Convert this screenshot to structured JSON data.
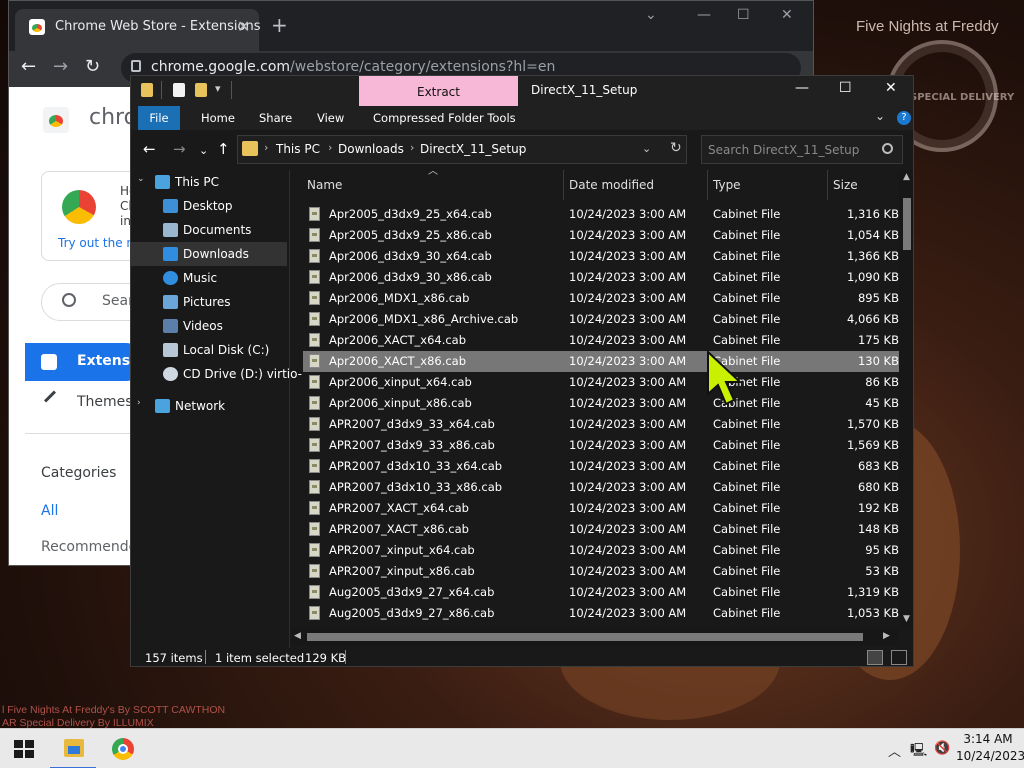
{
  "wallpaper": {
    "title": "Five Nights at Freddy",
    "stamp": "SPECIAL DELIVERY",
    "credit_line1": "l Five Nights At Freddy's By SCOTT CAWTHON",
    "credit_line2": "AR Special Delivery By ILLUMIX"
  },
  "chrome": {
    "tab_title": "Chrome Web Store - Extensions",
    "url_host": "chrome.google.com",
    "url_path": "/webstore/category/extensions?hl=en",
    "store_name": "chro",
    "promo_text_1": "He",
    "promo_text_2": "Ch",
    "promo_text_3": "in",
    "promo_link": "Try out the ne",
    "search_label": "Searc",
    "nav_extensions": "Extensio",
    "nav_themes": "Themes",
    "categories_label": "Categories",
    "all_label": "All",
    "recommended_label": "Recommende"
  },
  "explorer": {
    "title": "DirectX_11_Setup",
    "extract_tab": "Extract",
    "ribbon_tabs": [
      "File",
      "Home",
      "Share",
      "View",
      "Compressed Folder Tools"
    ],
    "breadcrumb": [
      "This PC",
      "Downloads",
      "DirectX_11_Setup"
    ],
    "search_placeholder": "Search DirectX_11_Setup",
    "nav_items": [
      {
        "label": "This PC",
        "icon": "this-pc-icon"
      },
      {
        "label": "Desktop",
        "icon": "desktop-icon"
      },
      {
        "label": "Documents",
        "icon": "documents-icon"
      },
      {
        "label": "Downloads",
        "icon": "downloads-icon"
      },
      {
        "label": "Music",
        "icon": "music-icon"
      },
      {
        "label": "Pictures",
        "icon": "pictures-icon"
      },
      {
        "label": "Videos",
        "icon": "videos-icon"
      },
      {
        "label": "Local Disk (C:)",
        "icon": "local-disk-icon"
      },
      {
        "label": "CD Drive (D:) virtio-",
        "icon": "cd-drive-icon"
      },
      {
        "label": "Network",
        "icon": "network-icon"
      }
    ],
    "columns": [
      "Name",
      "Date modified",
      "Type",
      "Size"
    ],
    "files": [
      {
        "name": "Apr2005_d3dx9_25_x64.cab",
        "date": "10/24/2023 3:00 AM",
        "type": "Cabinet File",
        "size": "1,316 KB"
      },
      {
        "name": "Apr2005_d3dx9_25_x86.cab",
        "date": "10/24/2023 3:00 AM",
        "type": "Cabinet File",
        "size": "1,054 KB"
      },
      {
        "name": "Apr2006_d3dx9_30_x64.cab",
        "date": "10/24/2023 3:00 AM",
        "type": "Cabinet File",
        "size": "1,366 KB"
      },
      {
        "name": "Apr2006_d3dx9_30_x86.cab",
        "date": "10/24/2023 3:00 AM",
        "type": "Cabinet File",
        "size": "1,090 KB"
      },
      {
        "name": "Apr2006_MDX1_x86.cab",
        "date": "10/24/2023 3:00 AM",
        "type": "Cabinet File",
        "size": "895 KB"
      },
      {
        "name": "Apr2006_MDX1_x86_Archive.cab",
        "date": "10/24/2023 3:00 AM",
        "type": "Cabinet File",
        "size": "4,066 KB"
      },
      {
        "name": "Apr2006_XACT_x64.cab",
        "date": "10/24/2023 3:00 AM",
        "type": "Cabinet File",
        "size": "175 KB"
      },
      {
        "name": "Apr2006_XACT_x86.cab",
        "date": "10/24/2023 3:00 AM",
        "type": "Cabinet File",
        "size": "130 KB"
      },
      {
        "name": "Apr2006_xinput_x64.cab",
        "date": "10/24/2023 3:00 AM",
        "type": "Cabinet File",
        "size": "86 KB"
      },
      {
        "name": "Apr2006_xinput_x86.cab",
        "date": "10/24/2023 3:00 AM",
        "type": "Cabinet File",
        "size": "45 KB"
      },
      {
        "name": "APR2007_d3dx9_33_x64.cab",
        "date": "10/24/2023 3:00 AM",
        "type": "Cabinet File",
        "size": "1,570 KB"
      },
      {
        "name": "APR2007_d3dx9_33_x86.cab",
        "date": "10/24/2023 3:00 AM",
        "type": "Cabinet File",
        "size": "1,569 KB"
      },
      {
        "name": "APR2007_d3dx10_33_x64.cab",
        "date": "10/24/2023 3:00 AM",
        "type": "Cabinet File",
        "size": "683 KB"
      },
      {
        "name": "APR2007_d3dx10_33_x86.cab",
        "date": "10/24/2023 3:00 AM",
        "type": "Cabinet File",
        "size": "680 KB"
      },
      {
        "name": "APR2007_XACT_x64.cab",
        "date": "10/24/2023 3:00 AM",
        "type": "Cabinet File",
        "size": "192 KB"
      },
      {
        "name": "APR2007_XACT_x86.cab",
        "date": "10/24/2023 3:00 AM",
        "type": "Cabinet File",
        "size": "148 KB"
      },
      {
        "name": "APR2007_xinput_x64.cab",
        "date": "10/24/2023 3:00 AM",
        "type": "Cabinet File",
        "size": "95 KB"
      },
      {
        "name": "APR2007_xinput_x86.cab",
        "date": "10/24/2023 3:00 AM",
        "type": "Cabinet File",
        "size": "53 KB"
      },
      {
        "name": "Aug2005_d3dx9_27_x64.cab",
        "date": "10/24/2023 3:00 AM",
        "type": "Cabinet File",
        "size": "1,319 KB"
      },
      {
        "name": "Aug2005_d3dx9_27_x86.cab",
        "date": "10/24/2023 3:00 AM",
        "type": "Cabinet File",
        "size": "1,053 KB"
      }
    ],
    "selected_index": 7,
    "status_items": "157 items",
    "status_selected": "1 item selected",
    "status_size": "129 KB"
  },
  "taskbar": {
    "time": "3:14 AM",
    "date": "10/24/2023"
  },
  "colors": {
    "ribbon_file": "#1b6fb4",
    "extract_tab": "#f7b7d6",
    "cursor": "#c8f000",
    "chrome_accent": "#1a73e8"
  }
}
